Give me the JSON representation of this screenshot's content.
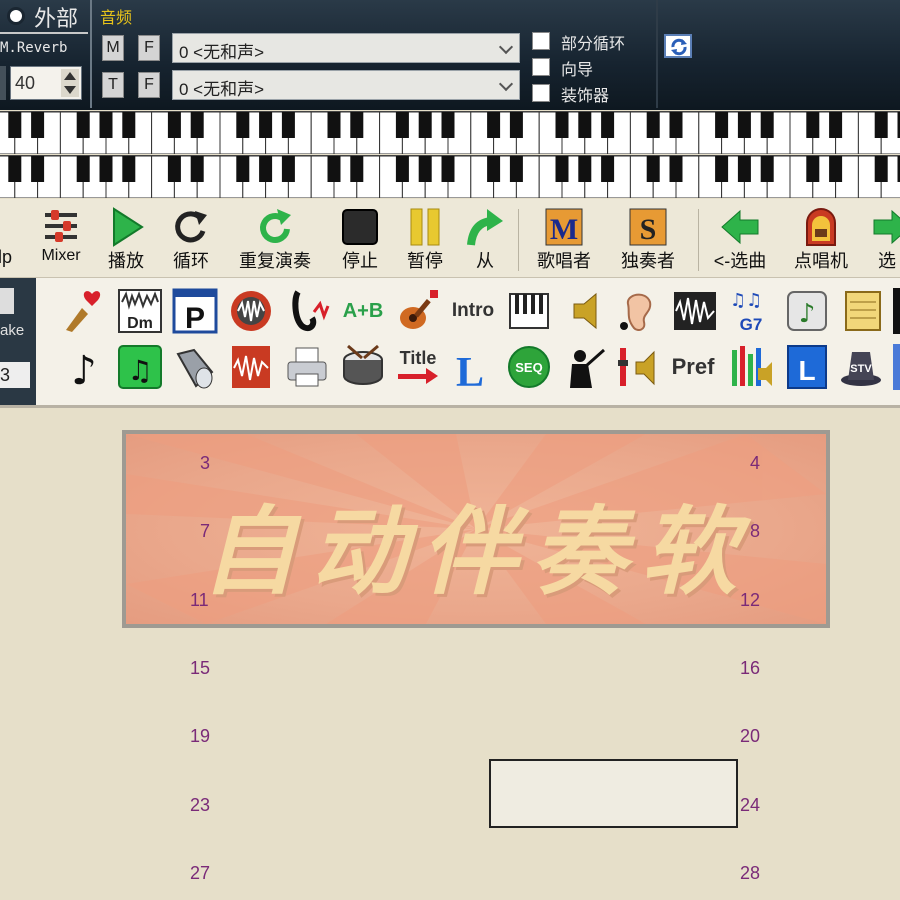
{
  "left_panel": {
    "external_label": "外部",
    "reverb_label": "M.Reverb",
    "reverb_value": "40"
  },
  "audio": {
    "label": "音频",
    "row1": {
      "m_label": "M",
      "f_label": "F",
      "combo_value": "0 <无和声>"
    },
    "row2": {
      "t_label": "T",
      "f_label": "F",
      "combo_value": "0 <无和声>"
    },
    "checkboxes": [
      {
        "label": "部分循环",
        "checked": false
      },
      {
        "label": "向导",
        "checked": false
      },
      {
        "label": "装饰器",
        "checked": false
      }
    ]
  },
  "transport": [
    {
      "label": "lp",
      "icon": "help-icon"
    },
    {
      "label": "Mixer",
      "icon": "mixer-icon"
    },
    {
      "label": "播放",
      "icon": "play-icon"
    },
    {
      "label": "循环",
      "icon": "loop-icon"
    },
    {
      "label": "重复演奏",
      "icon": "repeat-icon"
    },
    {
      "label": "停止",
      "icon": "stop-icon"
    },
    {
      "label": "暂停",
      "icon": "pause-icon"
    },
    {
      "label": "从",
      "icon": "from-icon"
    },
    {
      "label": "歌唱者",
      "icon": "melodist-icon"
    },
    {
      "label": "独奏者",
      "icon": "soloist-icon"
    },
    {
      "label": "<-选曲",
      "icon": "prev-song-icon"
    },
    {
      "label": "点唱机",
      "icon": "jukebox-icon"
    },
    {
      "label": "选",
      "icon": "next-song-icon"
    }
  ],
  "left_strip": {
    "label": "ake",
    "value": "3"
  },
  "icon_toolbar": {
    "row1": [
      "favorites-icon",
      "chord-dm-icon",
      "p-icon",
      "waveform-disc-icon",
      "saxophone-icon",
      "A+B",
      "guitar-icon",
      "Intro",
      "keyboard-icon",
      "speaker-icon",
      "ear-icon",
      "audio-track-icon",
      "G7",
      "note-button-icon",
      "notebook-icon"
    ],
    "row2": [
      "note-icon",
      "green-note-icon",
      "speaker-cone-icon",
      "audio-file-icon",
      "printer-icon",
      "drum-icon",
      "Title",
      "L",
      "SEQ",
      "conductor-icon",
      "volume-icon",
      "Pref",
      "mixer-bars-icon",
      "lyrics-icon",
      "stv-hat-icon"
    ]
  },
  "score": {
    "banner_text": "自动伴奏软",
    "bar_numbers": [
      "3",
      "4",
      "7",
      "8",
      "11",
      "12",
      "15",
      "16",
      "19",
      "20",
      "23",
      "24",
      "27",
      "28"
    ]
  }
}
